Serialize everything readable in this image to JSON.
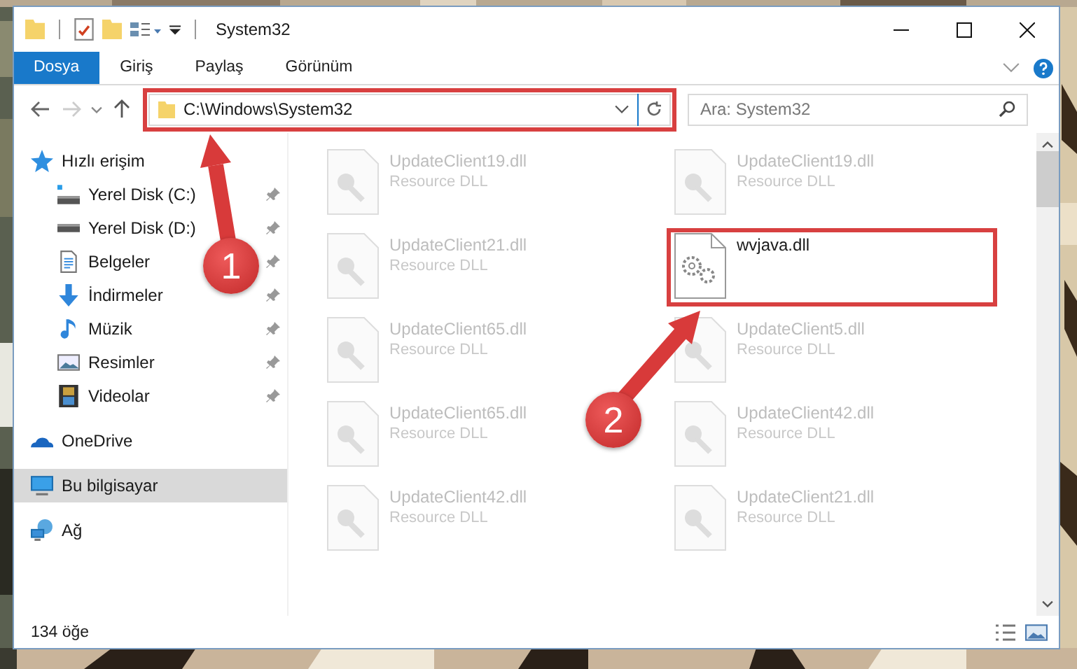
{
  "window": {
    "title": "System32"
  },
  "ribbon_tabs": [
    {
      "label": "Dosya",
      "kind": "file-menu"
    },
    {
      "label": "Giriş",
      "kind": "tab"
    },
    {
      "label": "Paylaş",
      "kind": "tab"
    },
    {
      "label": "Görünüm",
      "kind": "tab"
    }
  ],
  "address": {
    "path": "C:\\Windows\\System32"
  },
  "search": {
    "placeholder": "Ara: System32"
  },
  "nav": [
    {
      "label": "Hızlı erişim",
      "kind": "star",
      "selected": false,
      "children": [
        {
          "label": "Yerel Disk (C:)",
          "kind": "system-drive",
          "selected": false,
          "pinned": true
        },
        {
          "label": "Yerel Disk (D:)",
          "kind": "drive",
          "selected": false,
          "pinned": true
        },
        {
          "label": "Belgeler",
          "kind": "document",
          "selected": false,
          "pinned": true
        },
        {
          "label": "İndirmeler",
          "kind": "download",
          "selected": false,
          "pinned": true
        },
        {
          "label": "Müzik",
          "kind": "music",
          "selected": false,
          "pinned": true
        },
        {
          "label": "Resimler",
          "kind": "pictures",
          "selected": false,
          "pinned": true
        },
        {
          "label": "Videolar",
          "kind": "video",
          "selected": false,
          "pinned": true
        }
      ]
    },
    {
      "label": "OneDrive",
      "kind": "cloud",
      "selected": false
    },
    {
      "label": "Bu bilgisayar",
      "kind": "computer",
      "selected": true
    },
    {
      "label": "Ağ",
      "kind": "network",
      "selected": false
    }
  ],
  "files": [
    {
      "name": "UpdateClient19.dll",
      "type": "Resource DLL",
      "faded": true,
      "highlighted": false
    },
    {
      "name": "UpdateClient19.dll",
      "type": "Resource DLL",
      "faded": true,
      "highlighted": false
    },
    {
      "name": "UpdateClient21.dll",
      "type": "Resource DLL",
      "faded": true,
      "highlighted": false
    },
    {
      "name": "wvjava.dll",
      "faded": false,
      "highlighted": true
    },
    {
      "name": "UpdateClient65.dll",
      "type": "Resource DLL",
      "faded": true,
      "highlighted": false
    },
    {
      "name": "UpdateClient5.dll",
      "type": "Resource DLL",
      "faded": true,
      "highlighted": false
    },
    {
      "name": "UpdateClient65.dll",
      "type": "Resource DLL",
      "faded": true,
      "highlighted": false
    },
    {
      "name": "UpdateClient42.dll",
      "type": "Resource DLL",
      "faded": true,
      "highlighted": false
    },
    {
      "name": "UpdateClient42.dll",
      "type": "Resource DLL",
      "faded": true,
      "highlighted": false
    },
    {
      "name": "UpdateClient21.dll",
      "type": "Resource DLL",
      "faded": true,
      "highlighted": false
    }
  ],
  "status_bar": {
    "count": "134 öğe"
  },
  "annotations": [
    {
      "label": "1"
    },
    {
      "label": "2"
    }
  ]
}
